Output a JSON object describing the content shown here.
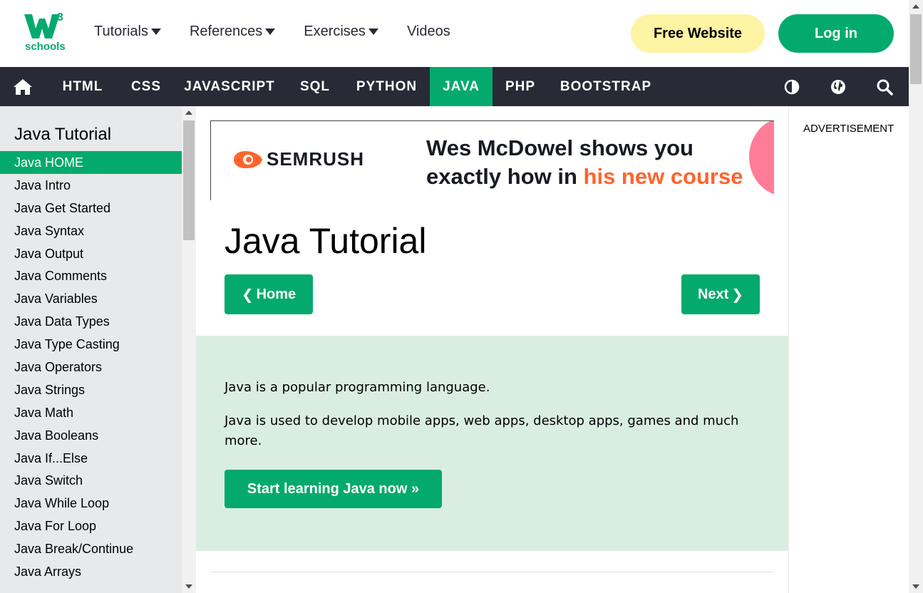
{
  "logo": {
    "brand": "schools",
    "superscript": "3"
  },
  "topnav": [
    {
      "label": "Tutorials",
      "caret": true
    },
    {
      "label": "References",
      "caret": true
    },
    {
      "label": "Exercises",
      "caret": true
    },
    {
      "label": "Videos",
      "caret": false
    }
  ],
  "header_buttons": {
    "free_website": "Free Website",
    "login": "Log in"
  },
  "langnav": [
    "HTML",
    "CSS",
    "JAVASCRIPT",
    "SQL",
    "PYTHON",
    "JAVA",
    "PHP",
    "BOOTSTRAP"
  ],
  "langnav_active": "JAVA",
  "sidebar": {
    "title": "Java Tutorial",
    "items": [
      "Java HOME",
      "Java Intro",
      "Java Get Started",
      "Java Syntax",
      "Java Output",
      "Java Comments",
      "Java Variables",
      "Java Data Types",
      "Java Type Casting",
      "Java Operators",
      "Java Strings",
      "Java Math",
      "Java Booleans",
      "Java If...Else",
      "Java Switch",
      "Java While Loop",
      "Java For Loop",
      "Java Break/Continue",
      "Java Arrays"
    ],
    "active_index": 0
  },
  "ad": {
    "brand": "SEMRUSH",
    "line1": "Wes McDowel shows you",
    "line2_prefix": "exactly how in ",
    "line2_highlight": "his new course"
  },
  "main": {
    "title": "Java Tutorial",
    "prev_label": "Home",
    "next_label": "Next",
    "intro_p1": "Java is a popular programming language.",
    "intro_p2": "Java is used to develop mobile apps, web apps, desktop apps, games and much more.",
    "start_button": "Start learning Java now »"
  },
  "right_column": {
    "advertisement": "ADVERTISEMENT"
  },
  "colors": {
    "accent": "#04AA6D",
    "dark_nav": "#282A35",
    "free_button": "#FFF4A3",
    "intro_bg": "#D9EEE1",
    "sidebar_bg": "#E7E9EB"
  }
}
